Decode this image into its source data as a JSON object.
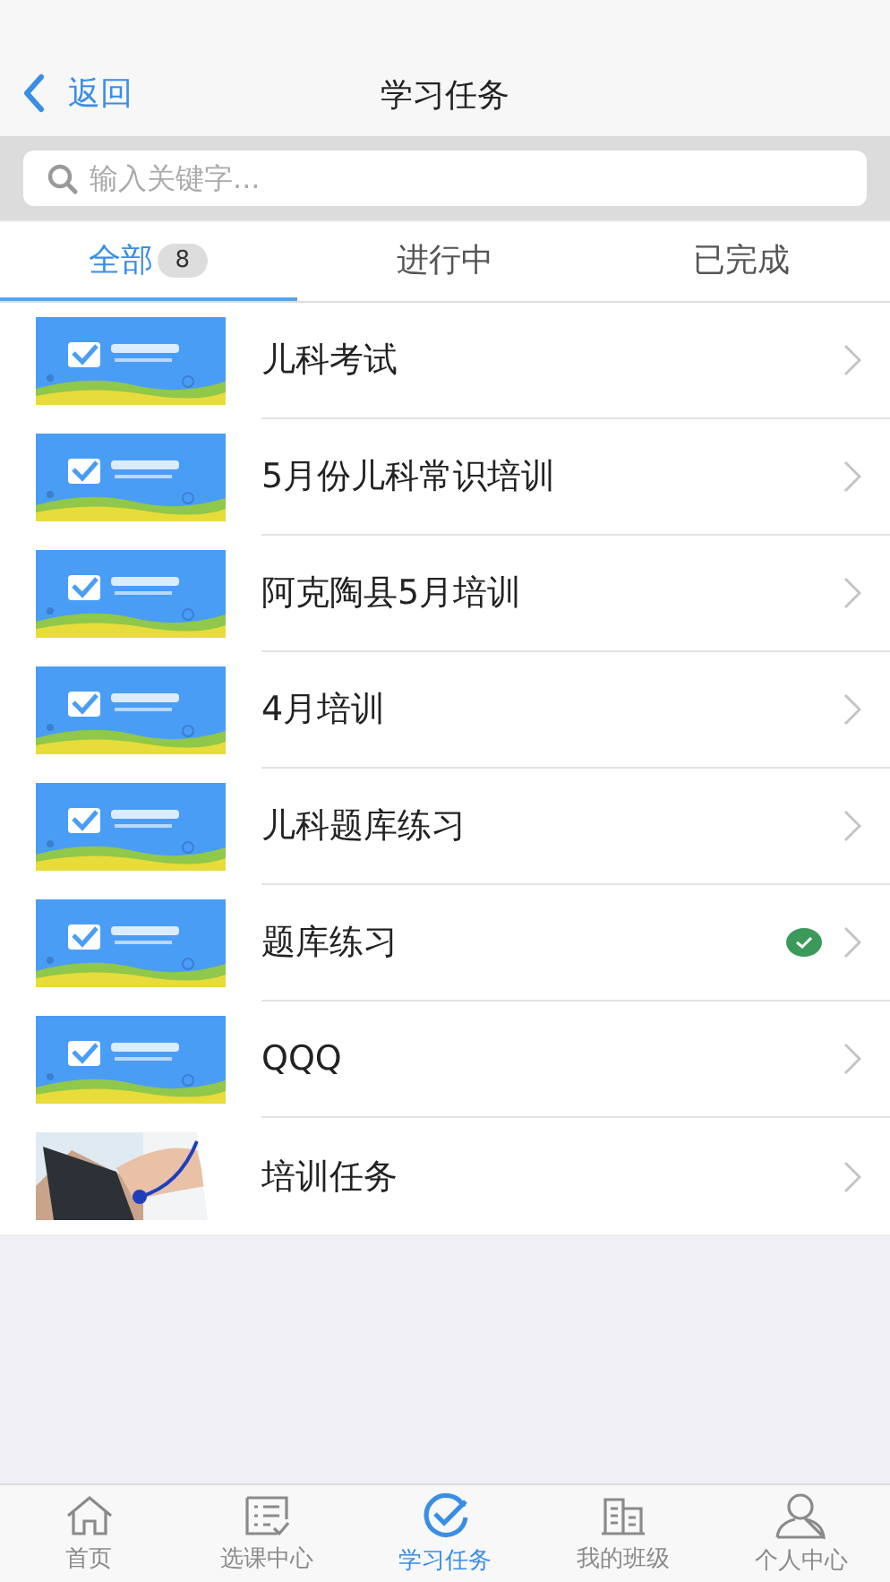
{
  "nav": {
    "back": "返回",
    "title": "学习任务"
  },
  "search": {
    "placeholder": "输入关键字..."
  },
  "tabs": [
    {
      "label": "全部",
      "badge": "8",
      "selected": true
    },
    {
      "label": "进行中",
      "selected": false
    },
    {
      "label": "已完成",
      "selected": false
    }
  ],
  "tasks": [
    {
      "title": "儿科考试",
      "kind": "banner",
      "done": false
    },
    {
      "title": "5月份儿科常识培训",
      "kind": "banner",
      "done": false
    },
    {
      "title": "阿克陶县5月培训",
      "kind": "banner",
      "done": false
    },
    {
      "title": "4月培训",
      "kind": "banner",
      "done": false
    },
    {
      "title": "儿科题库练习",
      "kind": "banner",
      "done": false
    },
    {
      "title": "题库练习",
      "kind": "banner",
      "done": true
    },
    {
      "title": "QQQ",
      "kind": "banner",
      "done": false
    },
    {
      "title": "培训任务",
      "done": false
    }
  ],
  "tabbar": [
    {
      "label": "首页",
      "selected": false
    },
    {
      "label": "选课中心",
      "selected": false
    },
    {
      "label": "学习任务",
      "selected": true
    },
    {
      "label": "我的班级",
      "selected": false
    },
    {
      "label": "个人中心",
      "selected": false
    }
  ]
}
